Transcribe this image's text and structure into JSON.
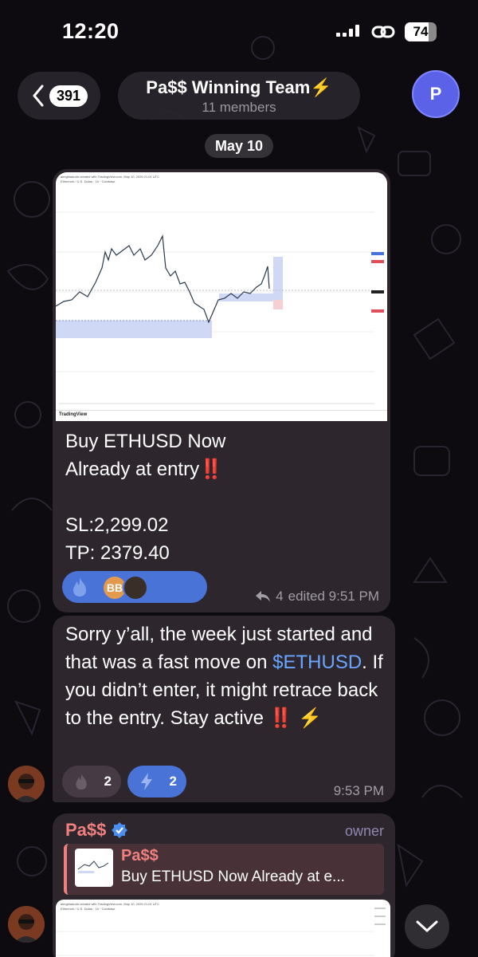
{
  "status_bar": {
    "time": "12:20",
    "battery": "74"
  },
  "header": {
    "back_count": "391",
    "title": "Pa$$ Winning Team⚡️",
    "subtitle": "11 members",
    "avatar_letter": "P"
  },
  "date_chip": "May 10",
  "message1": {
    "chart_credit": "aimgbladuda created with TradingView.com, May 10, 2026 21:01 UTC",
    "chart_symbol": "Ethereum / U.S. Dollar · 1h · Coinbase",
    "tv_logo_text": "TradingView",
    "line1": "Buy ETHUSD Now",
    "line2": "Already at entry",
    "line2_emoji": "‼️",
    "line3": "",
    "line4": "SL:2,299.02",
    "line5": "TP: 2379.40",
    "reaction_avatar_initials": "BB",
    "forward_count": "4",
    "meta": "edited 9:51 PM"
  },
  "message2": {
    "text_before": "Sorry y’all, the week just started and that was a fast move on ",
    "hashtag": "$ETHUSD",
    "text_after": ". If you didn’t enter, it might retrace back to the entry. Stay active ",
    "text_emoji": "‼️ ⚡️",
    "reaction1_count": "2",
    "reaction2_count": "2",
    "time": "9:53 PM"
  },
  "message3": {
    "sender": "Pa$$",
    "role": "owner",
    "reply_name": "Pa$$",
    "reply_text": "Buy ETHUSD Now Already at e..."
  },
  "colors": {
    "bubble": "#2d262c",
    "accent_blue": "#4a73d8",
    "hashtag_blue": "#6aa5ff",
    "sender_red": "#f08080",
    "alert_red": "#e0322c"
  },
  "icons": [
    "chevron-left-icon",
    "link-icon",
    "fire-icon",
    "lightning-icon",
    "reply-forward-icon",
    "verified-badge-icon",
    "chevron-down-icon"
  ]
}
